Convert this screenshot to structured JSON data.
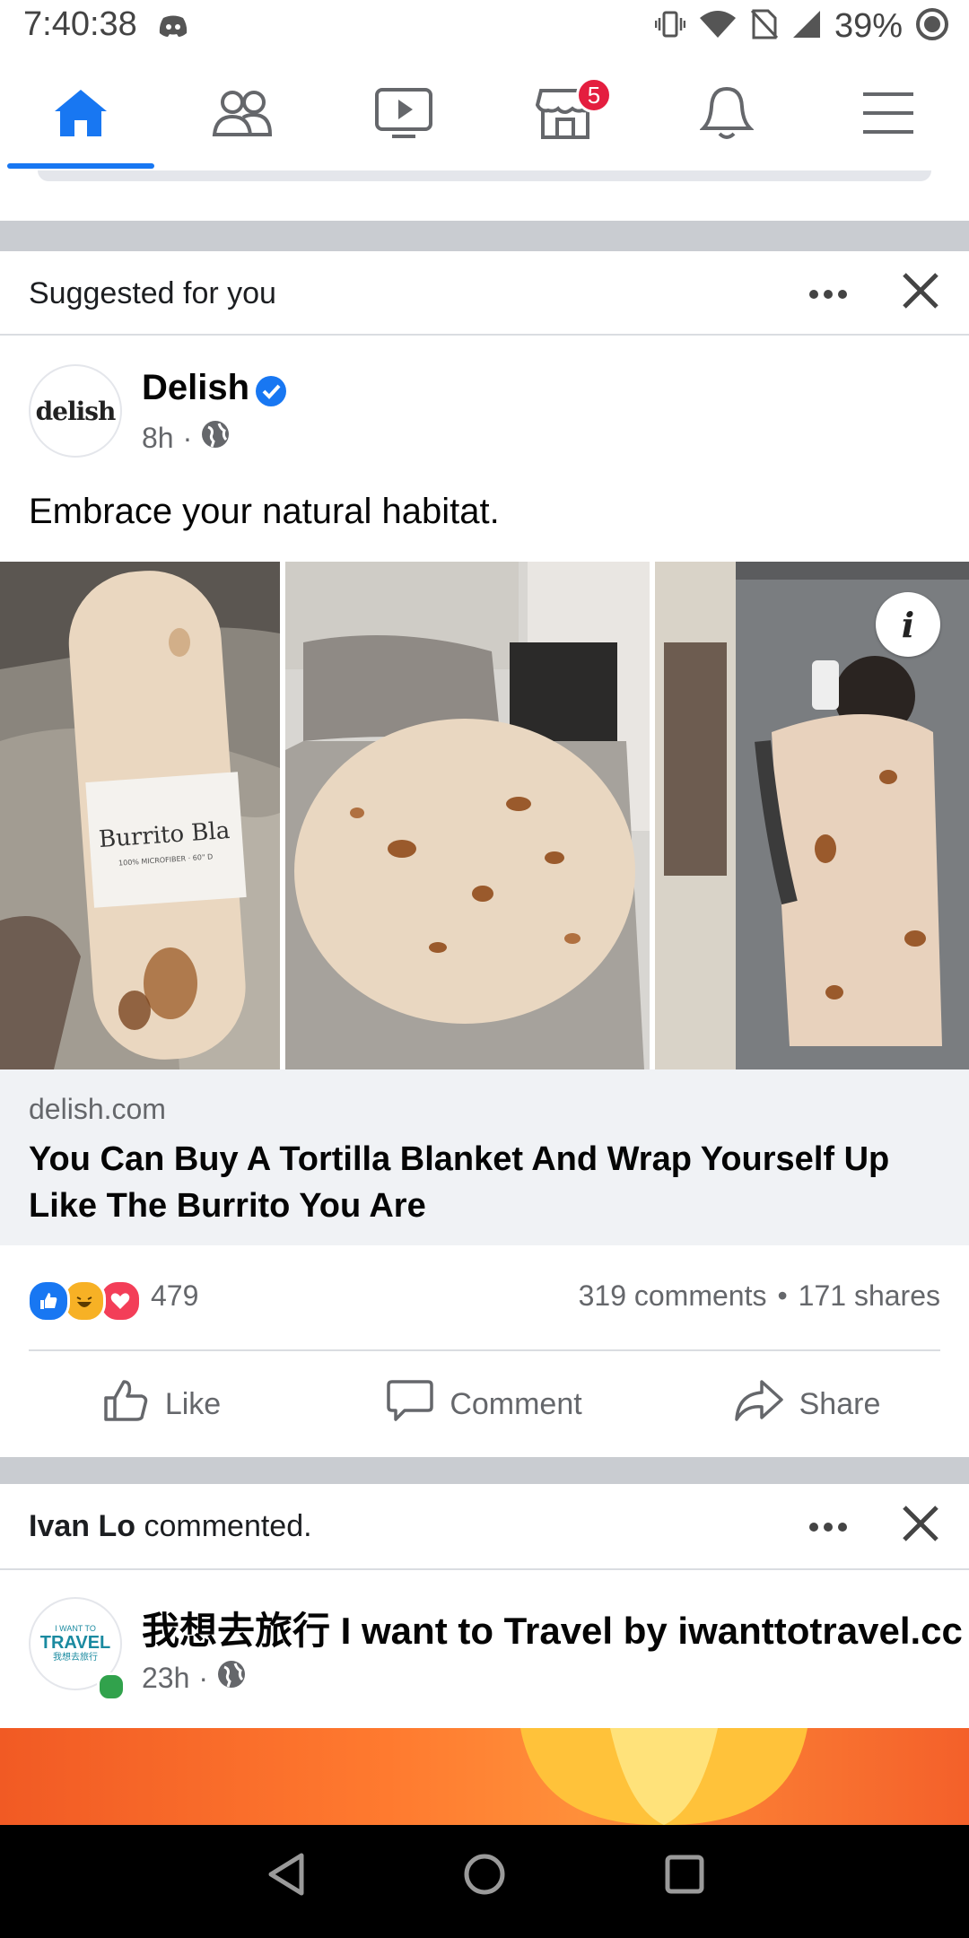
{
  "status_bar": {
    "time": "7:40:38",
    "battery": "39%",
    "icons": [
      "discord-icon",
      "vibrate-icon",
      "wifi-icon",
      "no-sim-icon",
      "signal-icon",
      "battery-saver-icon"
    ]
  },
  "nav": {
    "items": [
      {
        "name": "home",
        "icon": "home-icon",
        "active": true
      },
      {
        "name": "friends",
        "icon": "friends-icon"
      },
      {
        "name": "watch",
        "icon": "video-icon"
      },
      {
        "name": "marketplace",
        "icon": "marketplace-icon",
        "badge": "5"
      },
      {
        "name": "notifications",
        "icon": "bell-icon"
      },
      {
        "name": "menu",
        "icon": "hamburger-icon"
      }
    ],
    "accent": "#1877f2",
    "badge_color": "#e41e3f"
  },
  "post1": {
    "header_label": "Suggested for you",
    "author": "Delish",
    "avatar_text": "delish",
    "time": "8h",
    "text": "Embrace your natural habitat.",
    "photo_label": "Burrito Bla",
    "photo_sublabel": "100% MICROFIBER · 60\" D",
    "link_domain": "delish.com",
    "link_title": "You Can Buy A Tortilla Blanket And Wrap Yourself Up Like The Burrito You Are",
    "reaction_count": "479",
    "comments": "319 comments",
    "shares": "171 shares",
    "bullet": "•",
    "actions": {
      "like": "Like",
      "comment": "Comment",
      "share": "Share"
    }
  },
  "post2": {
    "commenter": "Ivan Lo",
    "header_rest": "commented.",
    "author": "我想去旅行 I want to Travel by iwanttotravel.cc",
    "time": "23h",
    "avatar_text_top": "I WANT TO",
    "avatar_text_main": "TRAVEL",
    "avatar_text_cn": "我想去旅行"
  },
  "separator_dot": "·"
}
